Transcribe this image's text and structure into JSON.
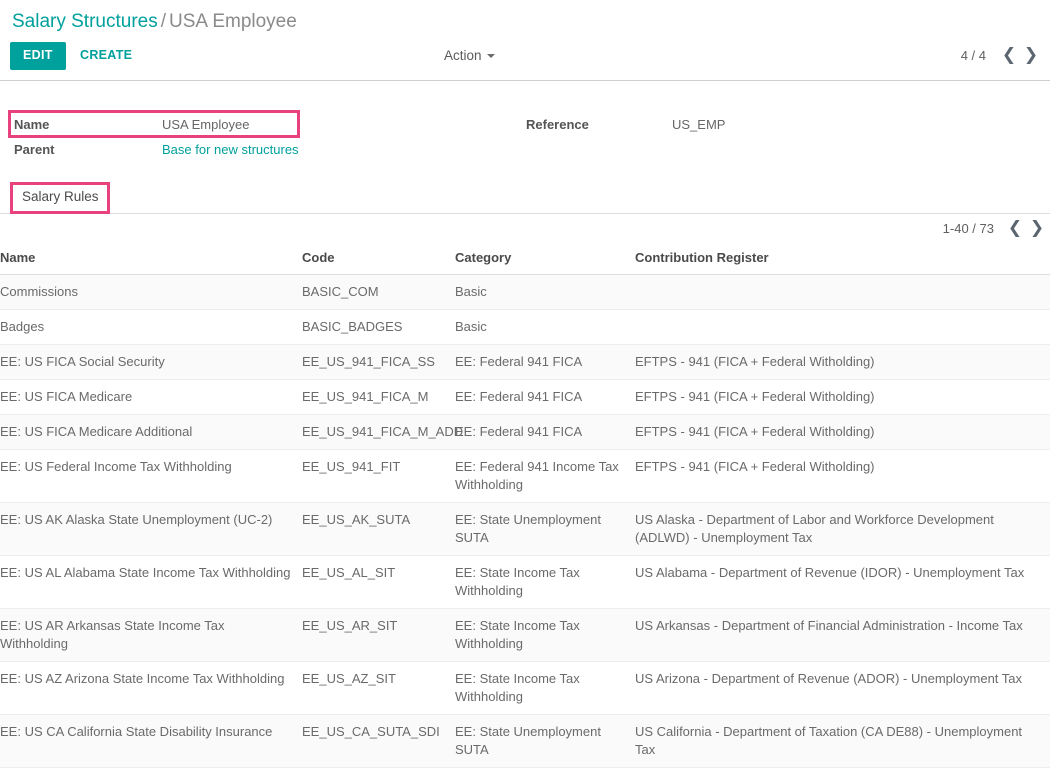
{
  "breadcrumb": {
    "root": "Salary Structures",
    "separator": "/",
    "current": "USA Employee"
  },
  "controls": {
    "edit_label": "EDIT",
    "create_label": "CREATE",
    "action_label": "Action",
    "record_pager": "4 / 4",
    "prev_icon": "chevron-left-icon",
    "next_icon": "chevron-right-icon"
  },
  "form": {
    "name": {
      "label": "Name",
      "value": "USA Employee"
    },
    "parent": {
      "label": "Parent",
      "value": "Base for new structures"
    },
    "reference": {
      "label": "Reference",
      "value": "US_EMP"
    }
  },
  "notebook": {
    "tabs": [
      {
        "label": "Salary Rules"
      }
    ],
    "active_tab": 0
  },
  "list": {
    "pager": "1-40 / 73",
    "columns": [
      "Name",
      "Code",
      "Category",
      "Contribution Register"
    ],
    "rows": [
      {
        "name": "Commissions",
        "code": "BASIC_COM",
        "category": "Basic",
        "register": ""
      },
      {
        "name": "Badges",
        "code": "BASIC_BADGES",
        "category": "Basic",
        "register": ""
      },
      {
        "name": "EE: US FICA Social Security",
        "code": "EE_US_941_FICA_SS",
        "category": "EE: Federal 941 FICA",
        "register": "EFTPS - 941 (FICA + Federal Witholding)"
      },
      {
        "name": "EE: US FICA Medicare",
        "code": "EE_US_941_FICA_M",
        "category": "EE: Federal 941 FICA",
        "register": "EFTPS - 941 (FICA + Federal Witholding)"
      },
      {
        "name": "EE: US FICA Medicare Additional",
        "code": "EE_US_941_FICA_M_ADD",
        "category": "EE: Federal 941 FICA",
        "register": "EFTPS - 941 (FICA + Federal Witholding)"
      },
      {
        "name": "EE: US Federal Income Tax Withholding",
        "code": "EE_US_941_FIT",
        "category": "EE: Federal 941 Income Tax Withholding",
        "register": "EFTPS - 941 (FICA + Federal Witholding)"
      },
      {
        "name": "EE: US AK Alaska State Unemployment (UC-2)",
        "code": "EE_US_AK_SUTA",
        "category": "EE: State Unemployment SUTA",
        "register": "US Alaska - Department of Labor and Workforce Development (ADLWD) - Unemployment Tax"
      },
      {
        "name": "EE: US AL Alabama State Income Tax Withholding",
        "code": "EE_US_AL_SIT",
        "category": "EE: State Income Tax Withholding",
        "register": "US Alabama - Department of Revenue (IDOR) - Unemployment Tax"
      },
      {
        "name": "EE: US AR Arkansas State Income Tax Withholding",
        "code": "EE_US_AR_SIT",
        "category": "EE: State Income Tax Withholding",
        "register": "US Arkansas - Department of Financial Administration - Income Tax"
      },
      {
        "name": "EE: US AZ Arizona State Income Tax Withholding",
        "code": "EE_US_AZ_SIT",
        "category": "EE: State Income Tax Withholding",
        "register": "US Arizona - Department of Revenue (ADOR) - Unemployment Tax"
      },
      {
        "name": "EE: US CA California State Disability Insurance",
        "code": "EE_US_CA_SUTA_SDI",
        "category": "EE: State Unemployment SUTA",
        "register": "US California - Department of Taxation (CA DE88) - Unemployment Tax"
      }
    ]
  },
  "annotations": {
    "highlight_color": "#e8427e",
    "targets": [
      "name-field",
      "salary-rules-tab"
    ]
  },
  "theme": {
    "accent": "#00A09D",
    "text": "#4c4c4c"
  }
}
